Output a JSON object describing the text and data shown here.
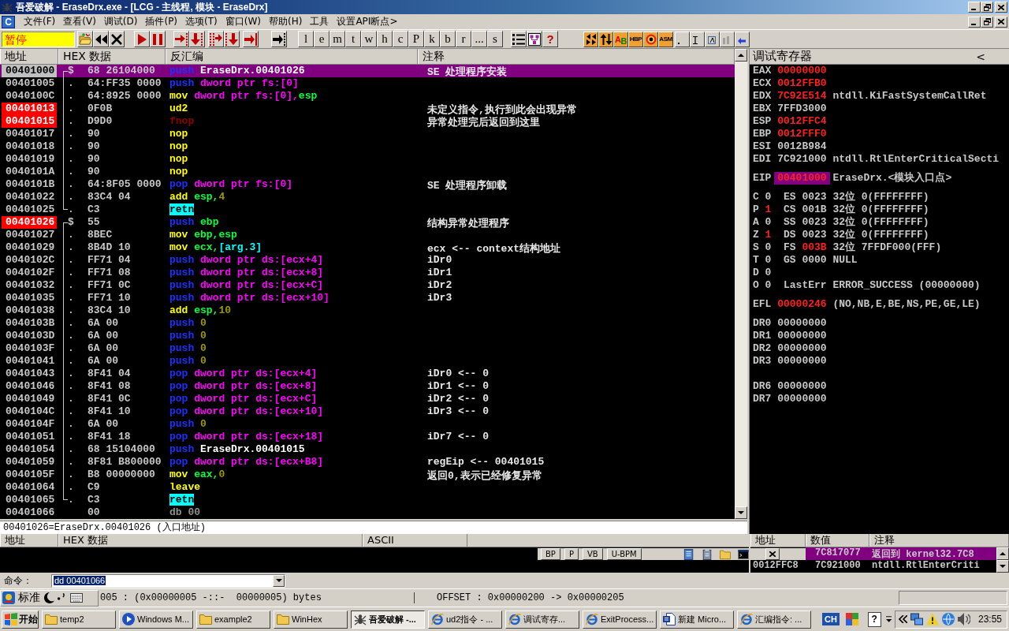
{
  "window": {
    "title": "吾爱破解 - EraseDrx.exe - [LCG - 主线程, 模块 - EraseDrx]"
  },
  "menu": {
    "window_icon": "C",
    "items": [
      "文件(F)",
      "查看(V)",
      "调试(D)",
      "插件(P)",
      "选项(T)",
      "窗口(W)",
      "帮助(H)",
      "工具",
      "设置API断点>"
    ]
  },
  "toolbar": {
    "status": "暂停",
    "letters": [
      "l",
      "e",
      "m",
      "t",
      "w",
      "h",
      "c",
      "P",
      "k",
      "b",
      "r",
      "...",
      "s"
    ],
    "help": "?",
    "ab": [
      "A",
      "B"
    ],
    "hbp": "HBP",
    "asm": "ASM"
  },
  "disassembly": {
    "columns": [
      "地址",
      "HEX 数据",
      "反汇编",
      "注释"
    ],
    "rows": [
      {
        "address": "00401000",
        "current": true,
        "breakpoint": false,
        "selected": true,
        "procedure_start": true,
        "procedure_end": false,
        "mark": "$",
        "hex": "68 26104000",
        "mnemonic": {
          "text": "push",
          "kind": "stack"
        },
        "operands": [
          {
            "text": "EraseDrx.00401026",
            "kind": "symbol"
          }
        ],
        "comment": "SE 处理程序安装"
      },
      {
        "address": "00401005",
        "current": false,
        "breakpoint": false,
        "selected": false,
        "procedure_start": false,
        "procedure_end": false,
        "mark": ".",
        "hex": "64:FF35 0000",
        "mnemonic": {
          "text": "push",
          "kind": "stack"
        },
        "operands": [
          {
            "text": "dword ptr fs:[0]",
            "kind": "memory"
          }
        ]
      },
      {
        "address": "0040100C",
        "current": false,
        "breakpoint": false,
        "selected": false,
        "procedure_start": false,
        "procedure_end": false,
        "mark": ".",
        "hex": "64:8925 0000",
        "mnemonic": {
          "text": "mov",
          "kind": "plain"
        },
        "operands": [
          {
            "text": "dword ptr fs:[0],",
            "kind": "memory"
          },
          {
            "text": "esp",
            "kind": "register"
          }
        ]
      },
      {
        "address": "00401013",
        "current": false,
        "breakpoint": true,
        "selected": false,
        "procedure_start": false,
        "procedure_end": false,
        "mark": ".",
        "hex": "0F0B",
        "mnemonic": {
          "text": "ud2",
          "kind": "plain"
        },
        "operands": [],
        "comment": "未定义指令,执行到此会出现异常"
      },
      {
        "address": "00401015",
        "current": false,
        "breakpoint": true,
        "selected": false,
        "procedure_start": false,
        "procedure_end": false,
        "mark": ".",
        "hex": "D9D0",
        "mnemonic": {
          "text": "fnop",
          "kind": "fpu"
        },
        "operands": [],
        "comment": "异常处理完后返回到这里"
      },
      {
        "address": "00401017",
        "current": false,
        "breakpoint": false,
        "selected": false,
        "procedure_start": false,
        "procedure_end": false,
        "mark": ".",
        "hex": "90",
        "mnemonic": {
          "text": "nop",
          "kind": "plain"
        },
        "operands": []
      },
      {
        "address": "00401018",
        "current": false,
        "breakpoint": false,
        "selected": false,
        "procedure_start": false,
        "procedure_end": false,
        "mark": ".",
        "hex": "90",
        "mnemonic": {
          "text": "nop",
          "kind": "plain"
        },
        "operands": []
      },
      {
        "address": "00401019",
        "current": false,
        "breakpoint": false,
        "selected": false,
        "procedure_start": false,
        "procedure_end": false,
        "mark": ".",
        "hex": "90",
        "mnemonic": {
          "text": "nop",
          "kind": "plain"
        },
        "operands": []
      },
      {
        "address": "0040101A",
        "current": false,
        "breakpoint": false,
        "selected": false,
        "procedure_start": false,
        "procedure_end": false,
        "mark": ".",
        "hex": "90",
        "mnemonic": {
          "text": "nop",
          "kind": "plain"
        },
        "operands": []
      },
      {
        "address": "0040101B",
        "current": false,
        "breakpoint": false,
        "selected": false,
        "procedure_start": false,
        "procedure_end": false,
        "mark": ".",
        "hex": "64:8F05 0000",
        "mnemonic": {
          "text": "pop",
          "kind": "stack"
        },
        "operands": [
          {
            "text": "dword ptr fs:[0]",
            "kind": "memory"
          }
        ],
        "comment": "SE 处理程序卸载"
      },
      {
        "address": "00401022",
        "current": false,
        "breakpoint": false,
        "selected": false,
        "procedure_start": false,
        "procedure_end": false,
        "mark": ".",
        "hex": "83C4 04",
        "mnemonic": {
          "text": "add",
          "kind": "plain"
        },
        "operands": [
          {
            "text": "esp,",
            "kind": "register"
          },
          {
            "text": "4",
            "kind": "constant"
          }
        ]
      },
      {
        "address": "00401025",
        "current": false,
        "breakpoint": false,
        "selected": false,
        "procedure_start": false,
        "procedure_end": true,
        "mark": ".",
        "hex": "C3",
        "mnemonic": {
          "text": "retn",
          "kind": "return"
        },
        "operands": []
      },
      {
        "address": "00401026",
        "current": false,
        "breakpoint": true,
        "selected": false,
        "procedure_start": true,
        "procedure_end": false,
        "mark": "$",
        "hex": "55",
        "mnemonic": {
          "text": "push",
          "kind": "stack"
        },
        "operands": [
          {
            "text": "ebp",
            "kind": "register"
          }
        ],
        "comment": "结构异常处理程序"
      },
      {
        "address": "00401027",
        "current": false,
        "breakpoint": false,
        "selected": false,
        "procedure_start": false,
        "procedure_end": false,
        "mark": ".",
        "hex": "8BEC",
        "mnemonic": {
          "text": "mov",
          "kind": "plain"
        },
        "operands": [
          {
            "text": "ebp,esp",
            "kind": "register"
          }
        ]
      },
      {
        "address": "00401029",
        "current": false,
        "breakpoint": false,
        "selected": false,
        "procedure_start": false,
        "procedure_end": false,
        "mark": ".",
        "hex": "8B4D 10",
        "mnemonic": {
          "text": "mov",
          "kind": "plain"
        },
        "operands": [
          {
            "text": "ecx,",
            "kind": "register"
          },
          {
            "text": "[arg.3]",
            "kind": "argument"
          }
        ],
        "comment": "ecx <-- context结构地址"
      },
      {
        "address": "0040102C",
        "current": false,
        "breakpoint": false,
        "selected": false,
        "procedure_start": false,
        "procedure_end": false,
        "mark": ".",
        "hex": "FF71 04",
        "mnemonic": {
          "text": "push",
          "kind": "stack"
        },
        "operands": [
          {
            "text": "dword ptr ds:[ecx+4]",
            "kind": "memory"
          }
        ],
        "comment": "iDr0"
      },
      {
        "address": "0040102F",
        "current": false,
        "breakpoint": false,
        "selected": false,
        "procedure_start": false,
        "procedure_end": false,
        "mark": ".",
        "hex": "FF71 08",
        "mnemonic": {
          "text": "push",
          "kind": "stack"
        },
        "operands": [
          {
            "text": "dword ptr ds:[ecx+8]",
            "kind": "memory"
          }
        ],
        "comment": "iDr1"
      },
      {
        "address": "00401032",
        "current": false,
        "breakpoint": false,
        "selected": false,
        "procedure_start": false,
        "procedure_end": false,
        "mark": ".",
        "hex": "FF71 0C",
        "mnemonic": {
          "text": "push",
          "kind": "stack"
        },
        "operands": [
          {
            "text": "dword ptr ds:[ecx+C]",
            "kind": "memory"
          }
        ],
        "comment": "iDr2"
      },
      {
        "address": "00401035",
        "current": false,
        "breakpoint": false,
        "selected": false,
        "procedure_start": false,
        "procedure_end": false,
        "mark": ".",
        "hex": "FF71 10",
        "mnemonic": {
          "text": "push",
          "kind": "stack"
        },
        "operands": [
          {
            "text": "dword ptr ds:[ecx+10]",
            "kind": "memory"
          }
        ],
        "comment": "iDr3"
      },
      {
        "address": "00401038",
        "current": false,
        "breakpoint": false,
        "selected": false,
        "procedure_start": false,
        "procedure_end": false,
        "mark": ".",
        "hex": "83C4 10",
        "mnemonic": {
          "text": "add",
          "kind": "plain"
        },
        "operands": [
          {
            "text": "esp,",
            "kind": "register"
          },
          {
            "text": "10",
            "kind": "constant"
          }
        ]
      },
      {
        "address": "0040103B",
        "current": false,
        "breakpoint": false,
        "selected": false,
        "procedure_start": false,
        "procedure_end": false,
        "mark": ".",
        "hex": "6A 00",
        "mnemonic": {
          "text": "push",
          "kind": "stack"
        },
        "operands": [
          {
            "text": "0",
            "kind": "constant"
          }
        ]
      },
      {
        "address": "0040103D",
        "current": false,
        "breakpoint": false,
        "selected": false,
        "procedure_start": false,
        "procedure_end": false,
        "mark": ".",
        "hex": "6A 00",
        "mnemonic": {
          "text": "push",
          "kind": "stack"
        },
        "operands": [
          {
            "text": "0",
            "kind": "constant"
          }
        ]
      },
      {
        "address": "0040103F",
        "current": false,
        "breakpoint": false,
        "selected": false,
        "procedure_start": false,
        "procedure_end": false,
        "mark": ".",
        "hex": "6A 00",
        "mnemonic": {
          "text": "push",
          "kind": "stack"
        },
        "operands": [
          {
            "text": "0",
            "kind": "constant"
          }
        ]
      },
      {
        "address": "00401041",
        "current": false,
        "breakpoint": false,
        "selected": false,
        "procedure_start": false,
        "procedure_end": false,
        "mark": ".",
        "hex": "6A 00",
        "mnemonic": {
          "text": "push",
          "kind": "stack"
        },
        "operands": [
          {
            "text": "0",
            "kind": "constant"
          }
        ]
      },
      {
        "address": "00401043",
        "current": false,
        "breakpoint": false,
        "selected": false,
        "procedure_start": false,
        "procedure_end": false,
        "mark": ".",
        "hex": "8F41 04",
        "mnemonic": {
          "text": "pop",
          "kind": "stack"
        },
        "operands": [
          {
            "text": "dword ptr ds:[ecx+4]",
            "kind": "memory"
          }
        ],
        "comment": "iDr0 <-- 0"
      },
      {
        "address": "00401046",
        "current": false,
        "breakpoint": false,
        "selected": false,
        "procedure_start": false,
        "procedure_end": false,
        "mark": ".",
        "hex": "8F41 08",
        "mnemonic": {
          "text": "pop",
          "kind": "stack"
        },
        "operands": [
          {
            "text": "dword ptr ds:[ecx+8]",
            "kind": "memory"
          }
        ],
        "comment": "iDr1 <-- 0"
      },
      {
        "address": "00401049",
        "current": false,
        "breakpoint": false,
        "selected": false,
        "procedure_start": false,
        "procedure_end": false,
        "mark": ".",
        "hex": "8F41 0C",
        "mnemonic": {
          "text": "pop",
          "kind": "stack"
        },
        "operands": [
          {
            "text": "dword ptr ds:[ecx+C]",
            "kind": "memory"
          }
        ],
        "comment": "iDr2 <-- 0"
      },
      {
        "address": "0040104C",
        "current": false,
        "breakpoint": false,
        "selected": false,
        "procedure_start": false,
        "procedure_end": false,
        "mark": ".",
        "hex": "8F41 10",
        "mnemonic": {
          "text": "pop",
          "kind": "stack"
        },
        "operands": [
          {
            "text": "dword ptr ds:[ecx+10]",
            "kind": "memory"
          }
        ],
        "comment": "iDr3 <-- 0"
      },
      {
        "address": "0040104F",
        "current": false,
        "breakpoint": false,
        "selected": false,
        "procedure_start": false,
        "procedure_end": false,
        "mark": ".",
        "hex": "6A 00",
        "mnemonic": {
          "text": "push",
          "kind": "stack"
        },
        "operands": [
          {
            "text": "0",
            "kind": "constant"
          }
        ]
      },
      {
        "address": "00401051",
        "current": false,
        "breakpoint": false,
        "selected": false,
        "procedure_start": false,
        "procedure_end": false,
        "mark": ".",
        "hex": "8F41 18",
        "mnemonic": {
          "text": "pop",
          "kind": "stack"
        },
        "operands": [
          {
            "text": "dword ptr ds:[ecx+18]",
            "kind": "memory"
          }
        ],
        "comment": "iDr7 <-- 0"
      },
      {
        "address": "00401054",
        "current": false,
        "breakpoint": false,
        "selected": false,
        "procedure_start": false,
        "procedure_end": false,
        "mark": ".",
        "hex": "68 15104000",
        "mnemonic": {
          "text": "push",
          "kind": "stack"
        },
        "operands": [
          {
            "text": "EraseDrx.00401015",
            "kind": "symbol"
          }
        ]
      },
      {
        "address": "00401059",
        "current": false,
        "breakpoint": false,
        "selected": false,
        "procedure_start": false,
        "procedure_end": false,
        "mark": ".",
        "hex": "8F81 B800000",
        "mnemonic": {
          "text": "pop",
          "kind": "stack"
        },
        "operands": [
          {
            "text": "dword ptr ds:[ecx+B8]",
            "kind": "memory"
          }
        ],
        "comment": "regEip <-- 00401015"
      },
      {
        "address": "0040105F",
        "current": false,
        "breakpoint": false,
        "selected": false,
        "procedure_start": false,
        "procedure_end": false,
        "mark": ".",
        "hex": "B8 00000000",
        "mnemonic": {
          "text": "mov",
          "kind": "plain"
        },
        "operands": [
          {
            "text": "eax,",
            "kind": "register"
          },
          {
            "text": "0",
            "kind": "constant"
          }
        ],
        "comment": "返回0,表示已经修复异常"
      },
      {
        "address": "00401064",
        "current": false,
        "breakpoint": false,
        "selected": false,
        "procedure_start": false,
        "procedure_end": false,
        "mark": ".",
        "hex": "C9",
        "mnemonic": {
          "text": "leave",
          "kind": "plain"
        },
        "operands": []
      },
      {
        "address": "00401065",
        "current": false,
        "breakpoint": false,
        "selected": false,
        "procedure_start": false,
        "procedure_end": true,
        "mark": ".",
        "hex": "C3",
        "mnemonic": {
          "text": "retn",
          "kind": "return"
        },
        "operands": []
      },
      {
        "address": "00401066",
        "current": false,
        "breakpoint": false,
        "selected": false,
        "procedure_start": false,
        "procedure_end": false,
        "hex": "00",
        "mnemonic": {
          "text": "db",
          "kind": "data"
        },
        "operands": [
          {
            "text": "00",
            "kind": "data"
          }
        ]
      }
    ],
    "info": "00401026=EraseDrx.00401026 (入口地址)"
  },
  "registers": {
    "title": "调试寄存器",
    "toggle": "<",
    "sections": [
      {
        "kind": "general",
        "rows": [
          {
            "name": "EAX",
            "value": "00000000",
            "changed": true,
            "highlighted": false
          },
          {
            "name": "ECX",
            "value": "0012FFB0",
            "changed": true,
            "highlighted": false
          },
          {
            "name": "EDX",
            "value": "7C92E514",
            "changed": true,
            "highlighted": false,
            "comment": "ntdll.KiFastSystemCallRet"
          },
          {
            "name": "EBX",
            "value": "7FFD3000",
            "changed": false,
            "highlighted": false
          },
          {
            "name": "ESP",
            "value": "0012FFC4",
            "changed": true,
            "highlighted": false
          },
          {
            "name": "EBP",
            "value": "0012FFF0",
            "changed": true,
            "highlighted": false
          },
          {
            "name": "ESI",
            "value": "0012B984",
            "changed": false,
            "highlighted": false
          },
          {
            "name": "EDI",
            "value": "7C921000",
            "changed": false,
            "highlighted": false,
            "comment": "ntdll.RtlEnterCriticalSecti"
          }
        ]
      },
      {
        "kind": "general",
        "rows": [
          {
            "name": "EIP",
            "value": "00401000",
            "changed": true,
            "highlighted": true,
            "comment": "EraseDrx.<模块入口点>"
          }
        ]
      },
      {
        "kind": "flags",
        "rows": [
          {
            "flag": "C",
            "bit": "0",
            "changed": false,
            "kind": "segment",
            "segment": "ES",
            "selector": "0023",
            "selector_changed": false,
            "info": "32位 0(FFFFFFFF)"
          },
          {
            "flag": "P",
            "bit": "1",
            "changed": true,
            "kind": "segment",
            "segment": "CS",
            "selector": "001B",
            "selector_changed": false,
            "info": "32位 0(FFFFFFFF)"
          },
          {
            "flag": "A",
            "bit": "0",
            "changed": false,
            "kind": "segment",
            "segment": "SS",
            "selector": "0023",
            "selector_changed": false,
            "info": "32位 0(FFFFFFFF)"
          },
          {
            "flag": "Z",
            "bit": "1",
            "changed": true,
            "kind": "segment",
            "segment": "DS",
            "selector": "0023",
            "selector_changed": false,
            "info": "32位 0(FFFFFFFF)"
          },
          {
            "flag": "S",
            "bit": "0",
            "changed": false,
            "kind": "segment",
            "segment": "FS",
            "selector": "003B",
            "selector_changed": true,
            "info": "32位 7FFDF000(FFF)"
          },
          {
            "flag": "T",
            "bit": "0",
            "changed": false,
            "kind": "segment",
            "segment": "GS",
            "selector": "0000",
            "selector_changed": false,
            "info": "NULL"
          },
          {
            "flag": "D",
            "bit": "0",
            "changed": false,
            "kind": "plain"
          },
          {
            "flag": "O",
            "bit": "0",
            "changed": false,
            "kind": "error",
            "label": "LastErr",
            "info": "ERROR_SUCCESS (00000000)"
          }
        ]
      },
      {
        "kind": "general",
        "rows": [
          {
            "name": "EFL",
            "value": "00000246",
            "changed": true,
            "highlighted": false,
            "comment": "(NO,NB,E,BE,NS,PE,GE,LE)"
          }
        ]
      },
      {
        "kind": "general",
        "rows": [
          {
            "name": "DR0",
            "value": "00000000",
            "changed": false,
            "highlighted": false
          },
          {
            "name": "DR1",
            "value": "00000000",
            "changed": false,
            "highlighted": false
          },
          {
            "name": "DR2",
            "value": "00000000",
            "changed": false,
            "highlighted": false
          },
          {
            "name": "DR3",
            "value": "00000000",
            "changed": false,
            "highlighted": false
          }
        ]
      },
      {
        "kind": "debug",
        "rows": [
          {
            "name": "DR6",
            "value": "00000000",
            "changed": false,
            "highlighted": false
          },
          {
            "name": "DR7",
            "value": "00000000",
            "changed": false,
            "highlighted": false
          }
        ]
      }
    ]
  },
  "dump": {
    "columns": [
      "地址",
      "HEX 数据",
      "ASCII"
    ],
    "buttons": [
      "BP",
      "P",
      "VB",
      "U-BPM"
    ]
  },
  "stack": {
    "columns": [
      "地址",
      "数值",
      "注释"
    ],
    "rows": [
      {
        "value": "7C817077",
        "comment": "返回到 kernel32.7C8",
        "selected": true
      },
      {
        "address": "0012FFC8",
        "value": "7C921000",
        "comment": "ntdll.RtlEnterCriti",
        "selected": false
      }
    ]
  },
  "command": {
    "label": "命令：",
    "value": "dd 00401066"
  },
  "status_bar": {
    "ime": "标准",
    "segments": [
      "005 : (0x00000005 -::-  00000005) bytes",
      "OFFSET : 0x00000200 -> 0x00000205"
    ]
  },
  "taskbar": {
    "start": "开始",
    "tasks": [
      {
        "label": "temp2",
        "kind": "folder",
        "selected": false
      },
      {
        "label": "Windows M...",
        "kind": "media",
        "selected": false
      },
      {
        "label": "example2",
        "kind": "folder",
        "selected": false
      },
      {
        "label": "WinHex",
        "kind": "folder",
        "selected": false
      },
      {
        "label": "吾爱破解 -...",
        "kind": "debugger",
        "selected": true
      },
      {
        "label": "ud2指令 - ...",
        "kind": "web",
        "selected": false
      },
      {
        "label": "调试寄存...",
        "kind": "web",
        "selected": false
      },
      {
        "label": "ExitProcess...",
        "kind": "web",
        "selected": false
      },
      {
        "label": "新建 Micro...",
        "kind": "document",
        "selected": false
      },
      {
        "label": "汇编指令: ...",
        "kind": "web",
        "selected": false
      }
    ],
    "language": "CH",
    "help": "?",
    "clock": "23:55"
  }
}
